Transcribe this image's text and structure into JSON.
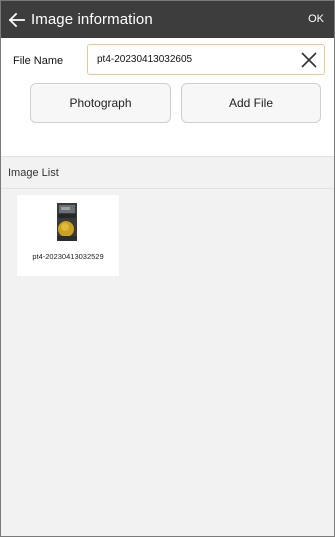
{
  "header": {
    "title": "Image information",
    "ok_label": "OK",
    "background": "#3d3d3d"
  },
  "file_name": {
    "label": "File Name",
    "value": "pt4-20230413032605"
  },
  "actions": {
    "photograph_label": "Photograph",
    "add_file_label": "Add File"
  },
  "image_list": {
    "heading": "Image List",
    "items": [
      {
        "caption": "pt4-20230413032529"
      }
    ]
  },
  "icons": {
    "back": "arrow-left-icon",
    "clear": "close-icon"
  }
}
